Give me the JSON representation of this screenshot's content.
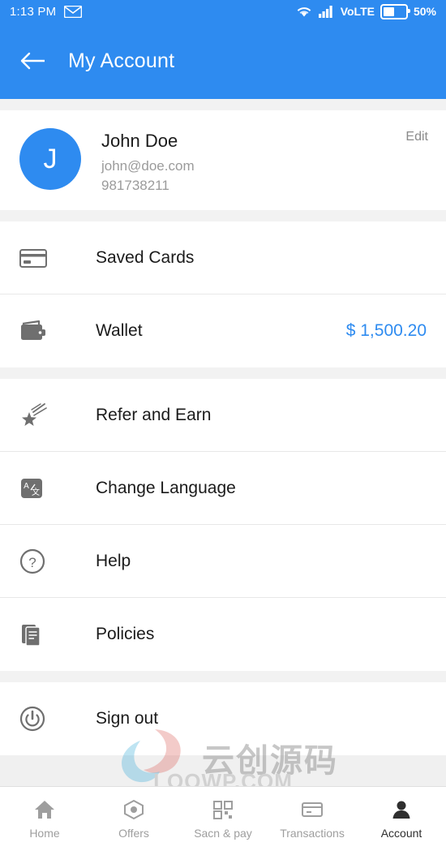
{
  "status_bar": {
    "time": "1:13 PM",
    "mail_icon": "mail-icon",
    "wifi_icon": "wifi-icon",
    "signal_icon": "signal-bars-icon",
    "network_label": "VoLTE",
    "battery_icon": "battery-icon",
    "battery_percent": "50%"
  },
  "app_bar": {
    "back_icon": "back-arrow-icon",
    "title": "My Account"
  },
  "profile": {
    "avatar_initial": "J",
    "name": "John Doe",
    "email": "john@doe.com",
    "phone": "981738211",
    "edit_label": "Edit"
  },
  "menu_groups": [
    {
      "items": [
        {
          "icon": "credit-card-icon",
          "label": "Saved Cards",
          "value": ""
        },
        {
          "icon": "wallet-icon",
          "label": "Wallet",
          "value": "$ 1,500.20"
        }
      ]
    },
    {
      "items": [
        {
          "icon": "shooting-star-icon",
          "label": "Refer and Earn",
          "value": ""
        },
        {
          "icon": "translate-icon",
          "label": "Change Language",
          "value": ""
        },
        {
          "icon": "question-mark-circle-icon",
          "label": "Help",
          "value": ""
        },
        {
          "icon": "document-icon",
          "label": "Policies",
          "value": ""
        }
      ]
    },
    {
      "items": [
        {
          "icon": "power-icon",
          "label": "Sign out",
          "value": ""
        }
      ]
    }
  ],
  "bottom_nav": {
    "items": [
      {
        "icon": "home-icon",
        "label": "Home",
        "active": false
      },
      {
        "icon": "offers-tag-icon",
        "label": "Offers",
        "active": false
      },
      {
        "icon": "qr-scan-icon",
        "label": "Sacn & pay",
        "active": false
      },
      {
        "icon": "transactions-icon",
        "label": "Transactions",
        "active": false
      },
      {
        "icon": "person-icon",
        "label": "Account",
        "active": true
      }
    ]
  },
  "watermark": {
    "text_cn": "云创源码",
    "text_en": "LOOWP.COM"
  },
  "colors": {
    "accent": "#2E8BF0",
    "page_bg": "#f2f2f2",
    "card_bg": "#ffffff",
    "text_primary": "#1b1b1b",
    "text_muted": "#9b9b9b"
  }
}
